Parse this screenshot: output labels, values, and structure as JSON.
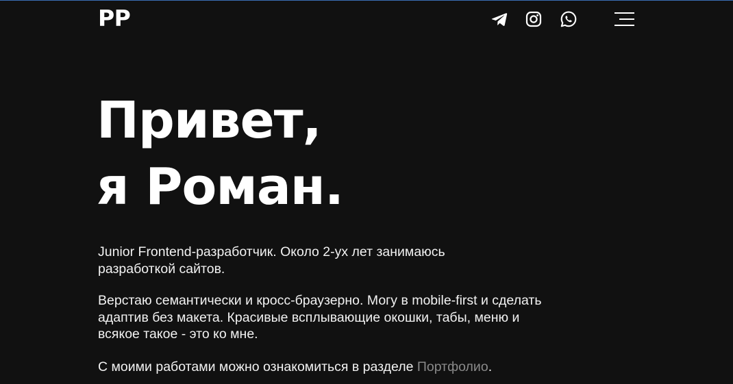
{
  "header": {
    "logo": "РР",
    "social": [
      {
        "icon": "telegram-icon"
      },
      {
        "icon": "instagram-icon"
      },
      {
        "icon": "whatsapp-icon"
      }
    ],
    "menu_icon": "burger-menu-icon"
  },
  "hero": {
    "title_line1": "Привет,",
    "title_line2": "я Роман."
  },
  "about": {
    "paragraph1": "Junior Frontend-разработчик. Около 2-ух лет занимаюсь разработкой сайтов.",
    "paragraph2": "Верстаю семантически и кросс-браузерно. Могу в mobile-first и сделать адаптив без макета. Красивые всплывающие окошки, табы, меню и всякое такое - это ко мне.",
    "paragraph3_prefix": "С моими работами можно ознакомиться в разделе ",
    "portfolio_link": "Портфолио",
    "paragraph3_suffix": "."
  },
  "colors": {
    "background": "#111111",
    "text": "#ffffff",
    "link": "#8a8a8a",
    "top_border": "#3b6fb6"
  }
}
